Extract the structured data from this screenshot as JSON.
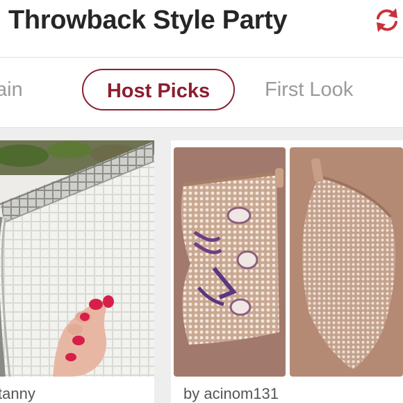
{
  "header": {
    "title": "Throwback Style Party",
    "refresh_icon": "refresh-icon",
    "accent_color": "#c8323c"
  },
  "tabs": [
    {
      "label": "ain",
      "active": false
    },
    {
      "label": "Host Picks",
      "active": true
    },
    {
      "label": "First Look",
      "active": false
    }
  ],
  "listings": [
    {
      "caption": "tanny",
      "image": "mirror-tile-clutch-photo"
    },
    {
      "caption": "by acinom131",
      "image": "beaded-pouch-photo"
    }
  ]
}
